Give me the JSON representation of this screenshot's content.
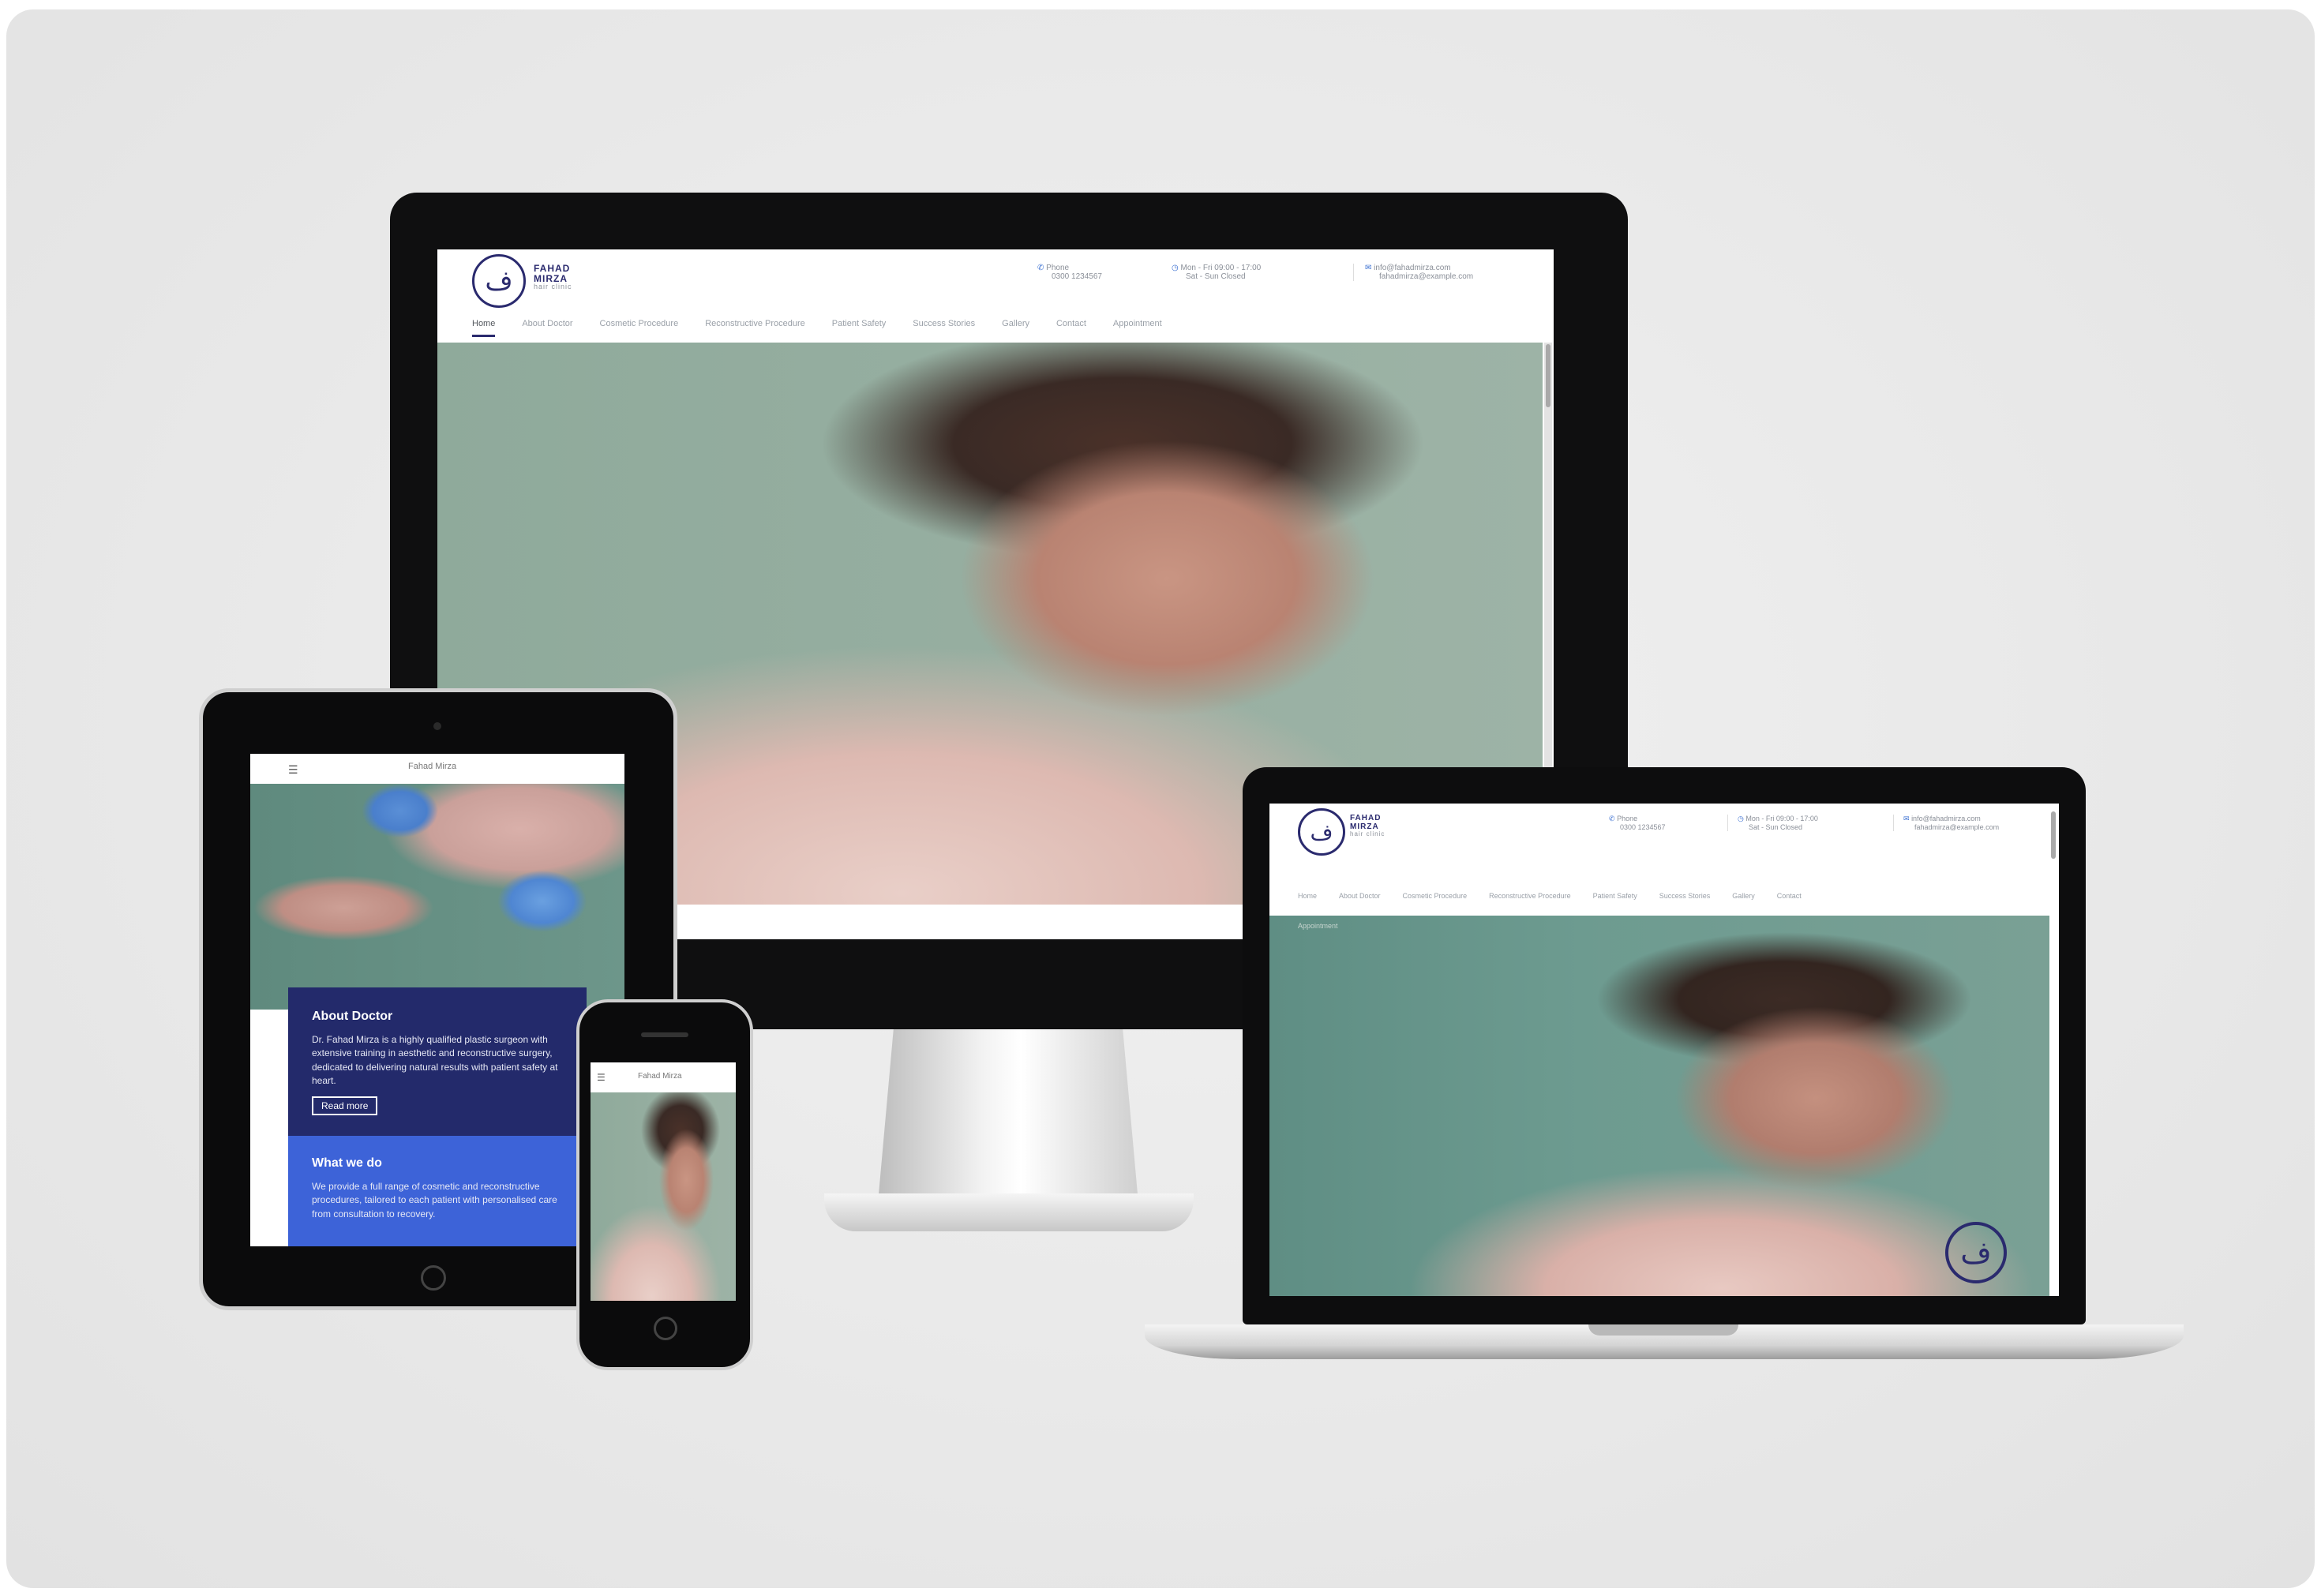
{
  "site": {
    "brand_line1": "FAHAD",
    "brand_line2": "MIRZA",
    "brand_tag": "hair clinic",
    "logo_glyph": "ف",
    "contact": {
      "phone_label": "Phone",
      "phone_value": "0300 1234567",
      "hours_label": "Mon - Fri 09:00 - 17:00",
      "hours_sub": "Sat - Sun Closed",
      "email_label": "info@fahadmirza.com",
      "email_sub": "fahadmirza@example.com"
    },
    "nav": [
      "Home",
      "About Doctor",
      "Cosmetic Procedure",
      "Reconstructive Procedure",
      "Patient Safety",
      "Success Stories",
      "Gallery",
      "Contact",
      "Appointment"
    ],
    "laptop_nav": [
      "Home",
      "About Doctor",
      "Cosmetic Procedure",
      "Reconstructive Procedure",
      "Patient Safety",
      "Success Stories",
      "Gallery",
      "Contact"
    ],
    "laptop_sub": "Appointment"
  },
  "tablet": {
    "menu_icon": "hamburger-icon",
    "header_text": "Fahad Mirza",
    "about_title": "About Doctor",
    "about_body": "Dr. Fahad Mirza is a highly qualified plastic surgeon with extensive training in aesthetic and reconstructive surgery, dedicated to delivering natural results with patient safety at heart.",
    "read_more": "Read more",
    "whatwe_title": "What we do",
    "whatwe_body": "We provide a full range of cosmetic and reconstructive procedures, tailored to each patient with personalised care from consultation to recovery."
  },
  "phone": {
    "header_text": "Fahad Mirza",
    "menu_icon": "hamburger-icon"
  },
  "colors": {
    "brand_navy": "#232a6b",
    "brand_blue": "#3d63d8"
  }
}
